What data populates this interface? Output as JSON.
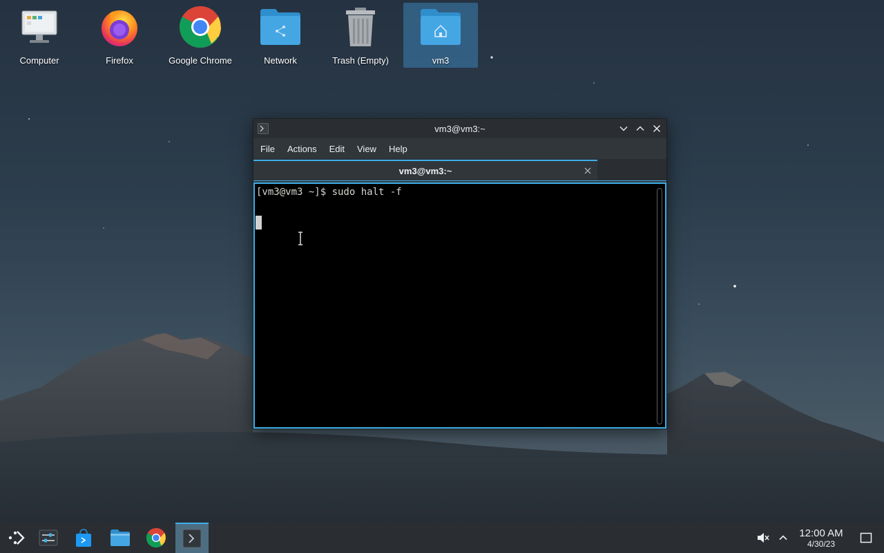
{
  "desktop": {
    "icons": [
      {
        "label": "Computer",
        "icon": "computer-icon"
      },
      {
        "label": "Firefox",
        "icon": "firefox-icon"
      },
      {
        "label": "Google Chrome",
        "icon": "chrome-icon"
      },
      {
        "label": "Network",
        "icon": "network-folder-icon"
      },
      {
        "label": "Trash (Empty)",
        "icon": "trash-icon"
      },
      {
        "label": "vm3",
        "icon": "home-folder-icon"
      }
    ]
  },
  "window": {
    "title": "vm3@vm3:~",
    "menu": [
      "File",
      "Actions",
      "Edit",
      "View",
      "Help"
    ],
    "tab_title": "vm3@vm3:~",
    "terminal_line": "[vm3@vm3 ~]$ sudo halt -f"
  },
  "taskbar": {
    "time": "12:00 AM",
    "date": "4/30/23",
    "apps": [
      "app-launcher-icon",
      "system-settings-icon",
      "discover-icon",
      "file-manager-icon",
      "chrome-icon",
      "konsole-icon"
    ]
  },
  "colors": {
    "accent": "#3daee9",
    "window_bg": "#31363b",
    "taskbar_bg": "#2a2e32",
    "terminal_bg": "#000000"
  }
}
